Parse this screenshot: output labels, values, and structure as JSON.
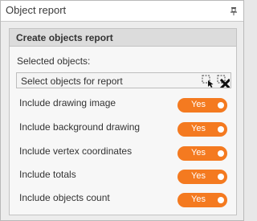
{
  "panel": {
    "title": "Object report",
    "pin_icon": "pin-icon"
  },
  "group": {
    "title": "Create objects report",
    "selected_label": "Selected objects:",
    "select_placeholder": "Select objects for report",
    "select_icons": [
      "select-pointer-icon",
      "clear-selection-icon"
    ]
  },
  "options": [
    {
      "label": "Include drawing image",
      "value": "Yes"
    },
    {
      "label": "Include background drawing",
      "value": "Yes"
    },
    {
      "label": "Include vertex coordinates",
      "value": "Yes"
    },
    {
      "label": "Include totals",
      "value": "Yes"
    },
    {
      "label": "Include objects count",
      "value": "Yes"
    }
  ],
  "colors": {
    "toggle_on": "#f47a20",
    "toggle_text": "#ffffff"
  }
}
